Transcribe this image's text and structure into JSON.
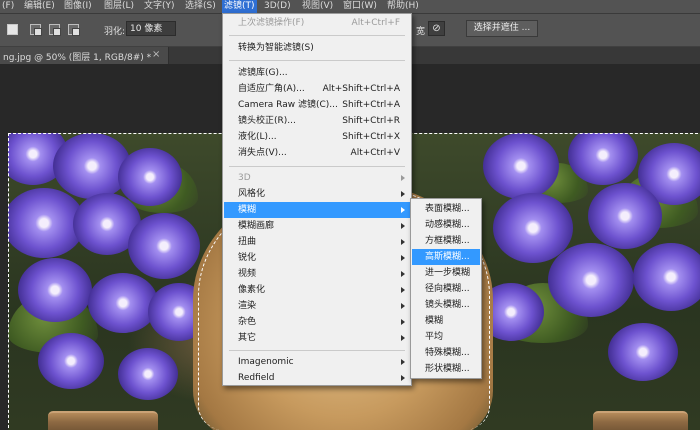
{
  "menubar": {
    "items": [
      "(F)",
      "编辑(E)",
      "图像(I)",
      "图层(L)",
      "文字(Y)",
      "选择(S)",
      "滤镜(T)",
      "3D(D)",
      "视图(V)",
      "窗口(W)",
      "帮助(H)"
    ],
    "active": "滤镜(T)"
  },
  "options": {
    "feather_label": "羽化:",
    "feather_value": "10 像素",
    "width_label_partial": "宽",
    "select_mask_button": "选择并遮住 ..."
  },
  "document": {
    "tab_label": "ng.jpg @ 50% (图层 1, RGB/8#) *",
    "close_glyph": "×"
  },
  "filter_menu": {
    "items": [
      {
        "label": "上次滤镜操作(F)",
        "shortcut": "Alt+Ctrl+F",
        "disabled": true
      },
      {
        "label": "转换为智能滤镜(S)"
      },
      {
        "label": "滤镜库(G)..."
      },
      {
        "label": "自适应广角(A)...",
        "shortcut": "Alt+Shift+Ctrl+A"
      },
      {
        "label": "Camera Raw 滤镜(C)...",
        "shortcut": "Shift+Ctrl+A"
      },
      {
        "label": "镜头校正(R)...",
        "shortcut": "Shift+Ctrl+R"
      },
      {
        "label": "液化(L)...",
        "shortcut": "Shift+Ctrl+X"
      },
      {
        "label": "消失点(V)...",
        "shortcut": "Alt+Ctrl+V"
      },
      {
        "label": "3D",
        "submenu": true,
        "disabled": true
      },
      {
        "label": "风格化",
        "submenu": true
      },
      {
        "label": "模糊",
        "submenu": true,
        "highlighted": true
      },
      {
        "label": "模糊画廊",
        "submenu": true
      },
      {
        "label": "扭曲",
        "submenu": true
      },
      {
        "label": "锐化",
        "submenu": true
      },
      {
        "label": "视频",
        "submenu": true
      },
      {
        "label": "像素化",
        "submenu": true
      },
      {
        "label": "渲染",
        "submenu": true
      },
      {
        "label": "杂色",
        "submenu": true
      },
      {
        "label": "其它",
        "submenu": true
      },
      {
        "label": "Imagenomic",
        "submenu": true
      },
      {
        "label": "Redfield",
        "submenu": true
      }
    ]
  },
  "blur_submenu": {
    "items": [
      {
        "label": "表面模糊..."
      },
      {
        "label": "动感模糊..."
      },
      {
        "label": "方框模糊..."
      },
      {
        "label": "高斯模糊...",
        "highlighted": true
      },
      {
        "label": "进一步模糊"
      },
      {
        "label": "径向模糊..."
      },
      {
        "label": "镜头模糊..."
      },
      {
        "label": "模糊"
      },
      {
        "label": "平均"
      },
      {
        "label": "特殊模糊..."
      },
      {
        "label": "形状模糊..."
      }
    ]
  },
  "colors": {
    "menu_highlight": "#3399ff",
    "active_menubar": "#2f6fd3",
    "chrome": "#535353"
  }
}
